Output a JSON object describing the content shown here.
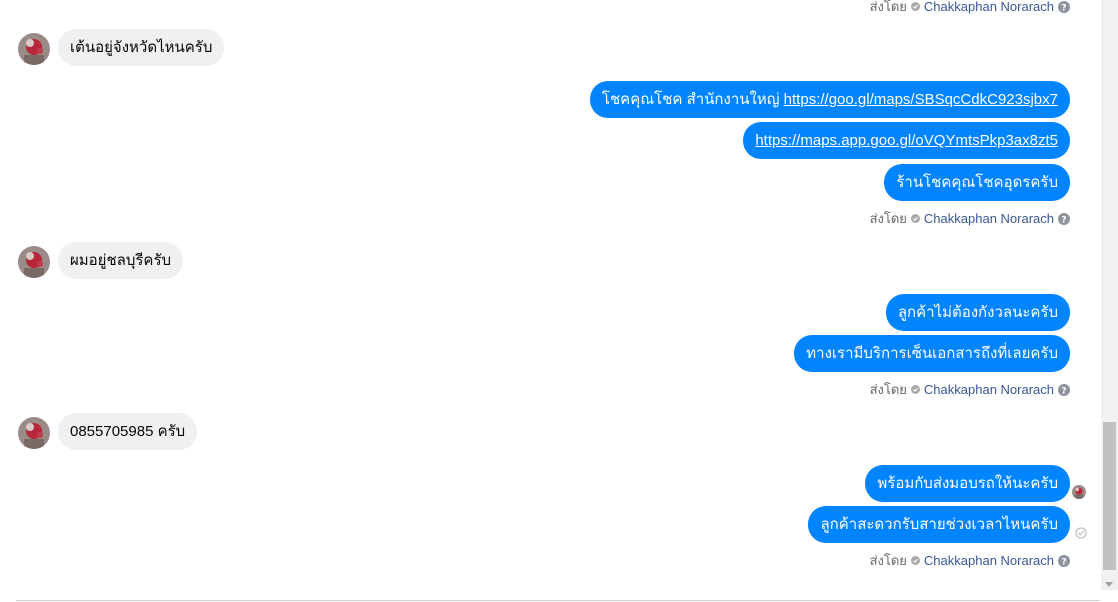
{
  "conversation": {
    "sent_by": {
      "prefix": "ส่งโดย",
      "name": "Chakkaphan Norarach"
    },
    "messages": {
      "m1": "เต้นอยู่จังหวัดไหนครับ",
      "m2_text": "โชคคุณโชค สำนักงานใหญ่ ",
      "m2_link": "https://goo.gl/maps/SBSqcCdkC923sjbx7",
      "m3_link": "https://maps.app.goo.gl/oVQYmtsPkp3ax8zt5",
      "m4": "ร้านโชคคุณโชคอุดรครับ",
      "m5": "ผมอยู่ชลบุรีครับ",
      "m6": "ลูกค้าไม่ต้องกังวลนะครับ",
      "m7": "ทางเรามีบริการเซ็นเอกสารถึงที่เลยครับ",
      "m8": "0855705985 ครับ",
      "m9": "พร้อมกับส่งมอบรถให้นะครับ",
      "m10": "ลูกค้าสะดวกรับสายช่วงเวลาไหนครับ"
    }
  },
  "colors": {
    "outgoing_bubble": "#0084ff",
    "incoming_bubble": "#f0f0f0",
    "sender_name": "#385898"
  },
  "icons": {
    "verified": "check-circle-icon",
    "help": "question-circle-icon",
    "delivered": "delivered-check-icon"
  }
}
